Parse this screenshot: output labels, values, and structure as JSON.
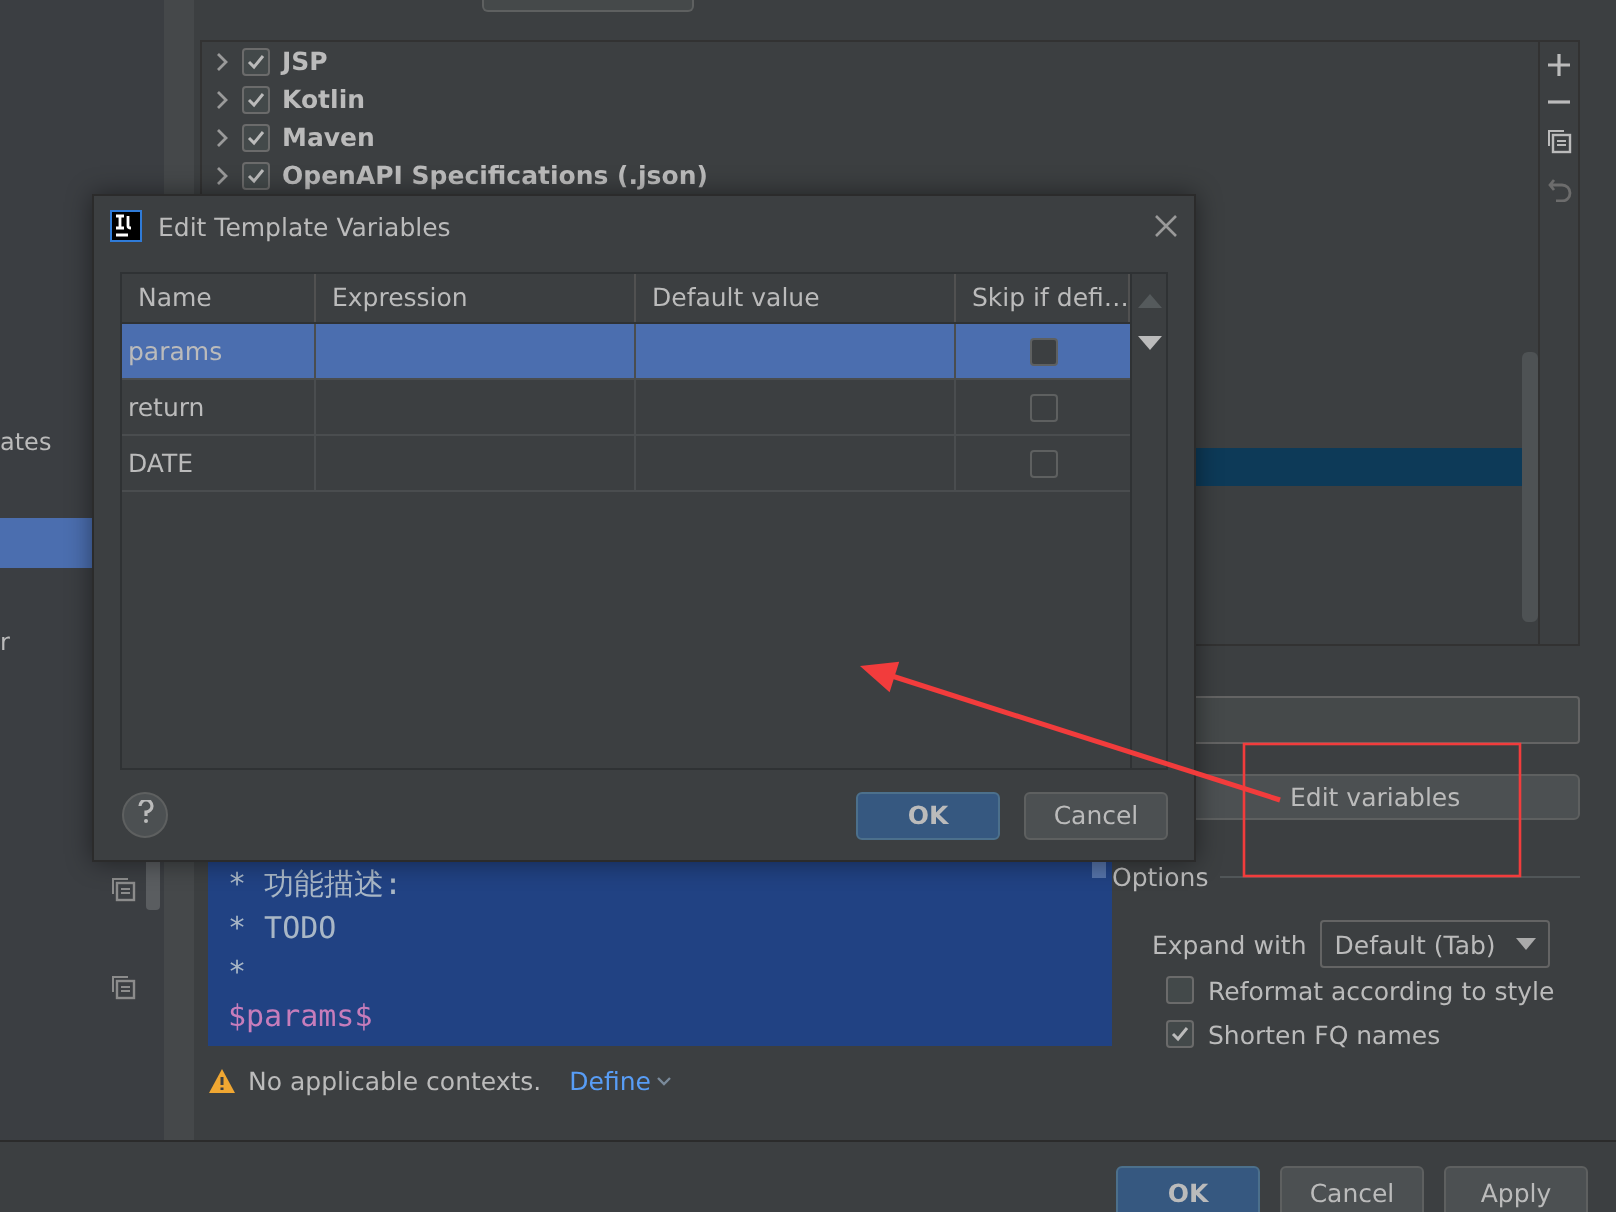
{
  "sidebar": {
    "items": [
      {
        "label": "ates",
        "selected": false
      },
      {
        "selected": true
      },
      {
        "label": "r",
        "selected": false
      }
    ]
  },
  "tree": {
    "items": [
      {
        "label": "JSP",
        "checked": true,
        "expanded": false
      },
      {
        "label": "Kotlin",
        "checked": true,
        "expanded": false
      },
      {
        "label": "Maven",
        "checked": true,
        "expanded": false
      },
      {
        "label": "OpenAPI Specifications (.json)",
        "checked": true,
        "expanded": false
      }
    ]
  },
  "editor": {
    "lines": [
      {
        "text": "* 功能描述:",
        "kind": "text"
      },
      {
        "text": "* TODO",
        "kind": "text"
      },
      {
        "text": "*",
        "kind": "text"
      },
      {
        "text": "$params$",
        "kind": "variable"
      }
    ]
  },
  "edit_variables_button": {
    "label": "Edit variables"
  },
  "options": {
    "title": "Options",
    "expand_with": {
      "label": "Expand with",
      "value": "Default (Tab)"
    },
    "checkboxes": [
      {
        "label": "Reformat according to style",
        "checked": false
      },
      {
        "label": "Shorten FQ names",
        "checked": true
      }
    ]
  },
  "context": {
    "warning": "No applicable contexts.",
    "link": "Define"
  },
  "footer": {
    "buttons": [
      {
        "label": "OK",
        "kind": "primary"
      },
      {
        "label": "Cancel",
        "kind": "normal"
      },
      {
        "label": "Apply",
        "kind": "normal"
      }
    ]
  },
  "dialog": {
    "title": "Edit Template Variables",
    "table": {
      "columns": [
        "Name",
        "Expression",
        "Default value",
        "Skip if defi…"
      ],
      "rows": [
        {
          "name": "params",
          "skip": false,
          "selected": true
        },
        {
          "name": "return",
          "skip": false,
          "selected": false
        },
        {
          "name": "DATE",
          "skip": false,
          "selected": false
        }
      ]
    },
    "buttons": [
      {
        "label": "OK",
        "kind": "primary"
      },
      {
        "label": "Cancel",
        "kind": "normal"
      }
    ]
  }
}
